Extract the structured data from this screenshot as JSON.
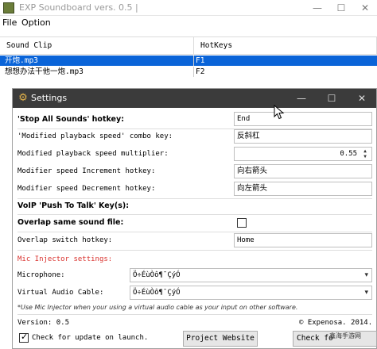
{
  "app": {
    "title": "EXP Soundboard vers. 0.5 |",
    "menu": [
      "File",
      "Option"
    ],
    "columns": [
      "Sound Clip",
      "HotKeys"
    ],
    "rows": [
      {
        "clip": "开炮.mp3",
        "hotkey": "F1",
        "selected": true
      },
      {
        "clip": "想想办法干他一炮.mp3",
        "hotkey": "F2",
        "selected": false
      }
    ]
  },
  "settings": {
    "title": "Settings",
    "stop_all": {
      "label": "'Stop All Sounds' hotkey:",
      "value": "End"
    },
    "modified_combo": {
      "label": "'Modified playback speed' combo key:",
      "value": "反斜杠"
    },
    "multiplier": {
      "label": "Modified playback speed multiplier:",
      "value": "0.55"
    },
    "increment": {
      "label": "Modifier speed Increment hotkey:",
      "value": "向右箭头"
    },
    "decrement": {
      "label": "Modifier speed Decrement hotkey:",
      "value": "向左箭头"
    },
    "voip": {
      "label": "VoIP 'Push To Talk' Key(s):",
      "value": ""
    },
    "overlap_same": {
      "label": "Overlap same sound file:",
      "checked": false
    },
    "overlap_switch": {
      "label": "Overlap switch hotkey:",
      "value": "Home"
    },
    "mic_section": "Mic Injector settings:",
    "microphone": {
      "label": "Microphone:",
      "value": "Ö÷ÉùÒô¶¯ÇýÓ"
    },
    "virtual_cable": {
      "label": "Virtual Audio Cable:",
      "value": "Ö÷ÉùÒô¶¯ÇýÓ"
    },
    "note": "*Use Mic Injector when your using a virtual audio cable as your input on other software.",
    "version": "Version: 0.5",
    "copyright": "© Expenosa. 2014.",
    "check_update": {
      "label": "Check for update on launch.",
      "checked": true
    },
    "project_button": "Project Website",
    "check_button": "Check fo"
  },
  "watermark": "鑫海手游网"
}
